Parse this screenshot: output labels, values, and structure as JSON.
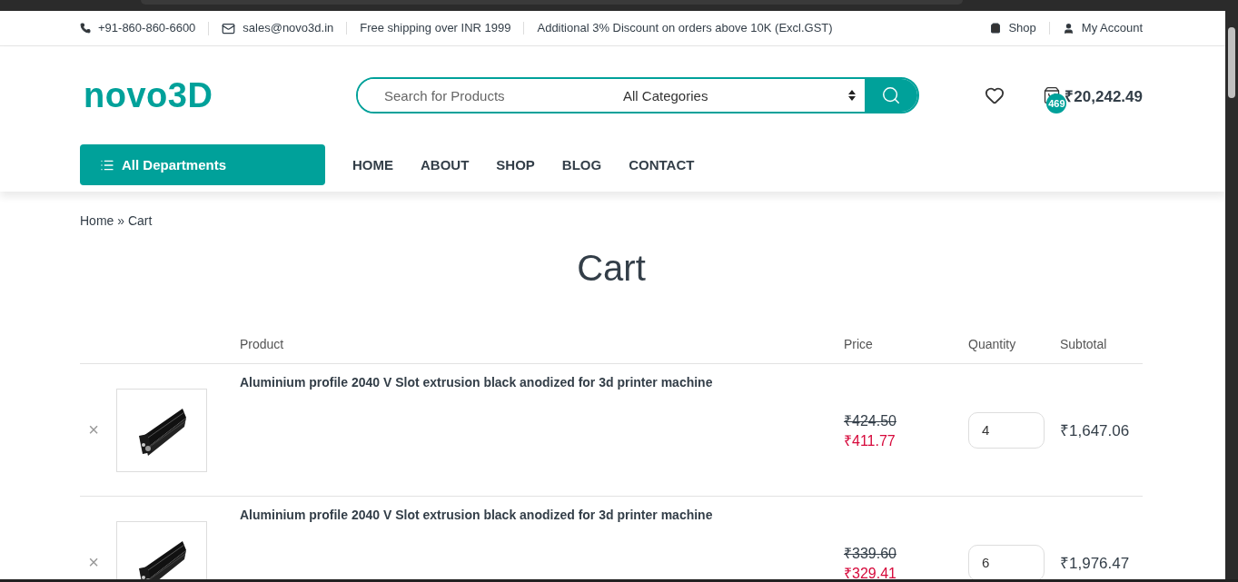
{
  "topbar": {
    "contacts": [
      {
        "kind": "phone",
        "text": "+91-860-860-6600"
      },
      {
        "kind": "email",
        "text": "sales@novo3d.in"
      },
      {
        "kind": "plain",
        "text": "Free shipping over INR 1999"
      },
      {
        "kind": "plain",
        "text": "Additional 3% Discount on orders above 10K (Excl.GST)"
      }
    ],
    "links": [
      {
        "kind": "shop",
        "text": "Shop"
      },
      {
        "kind": "account",
        "text": "My Account"
      }
    ]
  },
  "header": {
    "logo": "novo3D",
    "search": {
      "placeholder": "Search for Products",
      "category": "All Categories"
    },
    "cart": {
      "count": "469",
      "total": "₹20,242.49"
    }
  },
  "departments": "All Departments",
  "nav": [
    {
      "label": "HOME"
    },
    {
      "label": "ABOUT"
    },
    {
      "label": "SHOP"
    },
    {
      "label": "BLOG"
    },
    {
      "label": "CONTACT"
    }
  ],
  "breadcrumb": "Home » Cart",
  "title": "Cart",
  "table": {
    "columns": [
      "Product",
      "Price",
      "Quantity",
      "Subtotal"
    ],
    "rows": [
      {
        "remove": "×",
        "product": "Aluminium profile 2040 V Slot extrusion black anodized for 3d printer machine",
        "old_price": "₹424.50",
        "price": "₹411.77",
        "quantity": "4",
        "subtotal": "₹1,647.06"
      },
      {
        "remove": "×",
        "product": "Aluminium profile 2040 V Slot extrusion black anodized for 3d printer machine",
        "old_price": "₹339.60",
        "price": "₹329.41",
        "quantity": "6",
        "subtotal": "₹1,976.47"
      }
    ]
  }
}
